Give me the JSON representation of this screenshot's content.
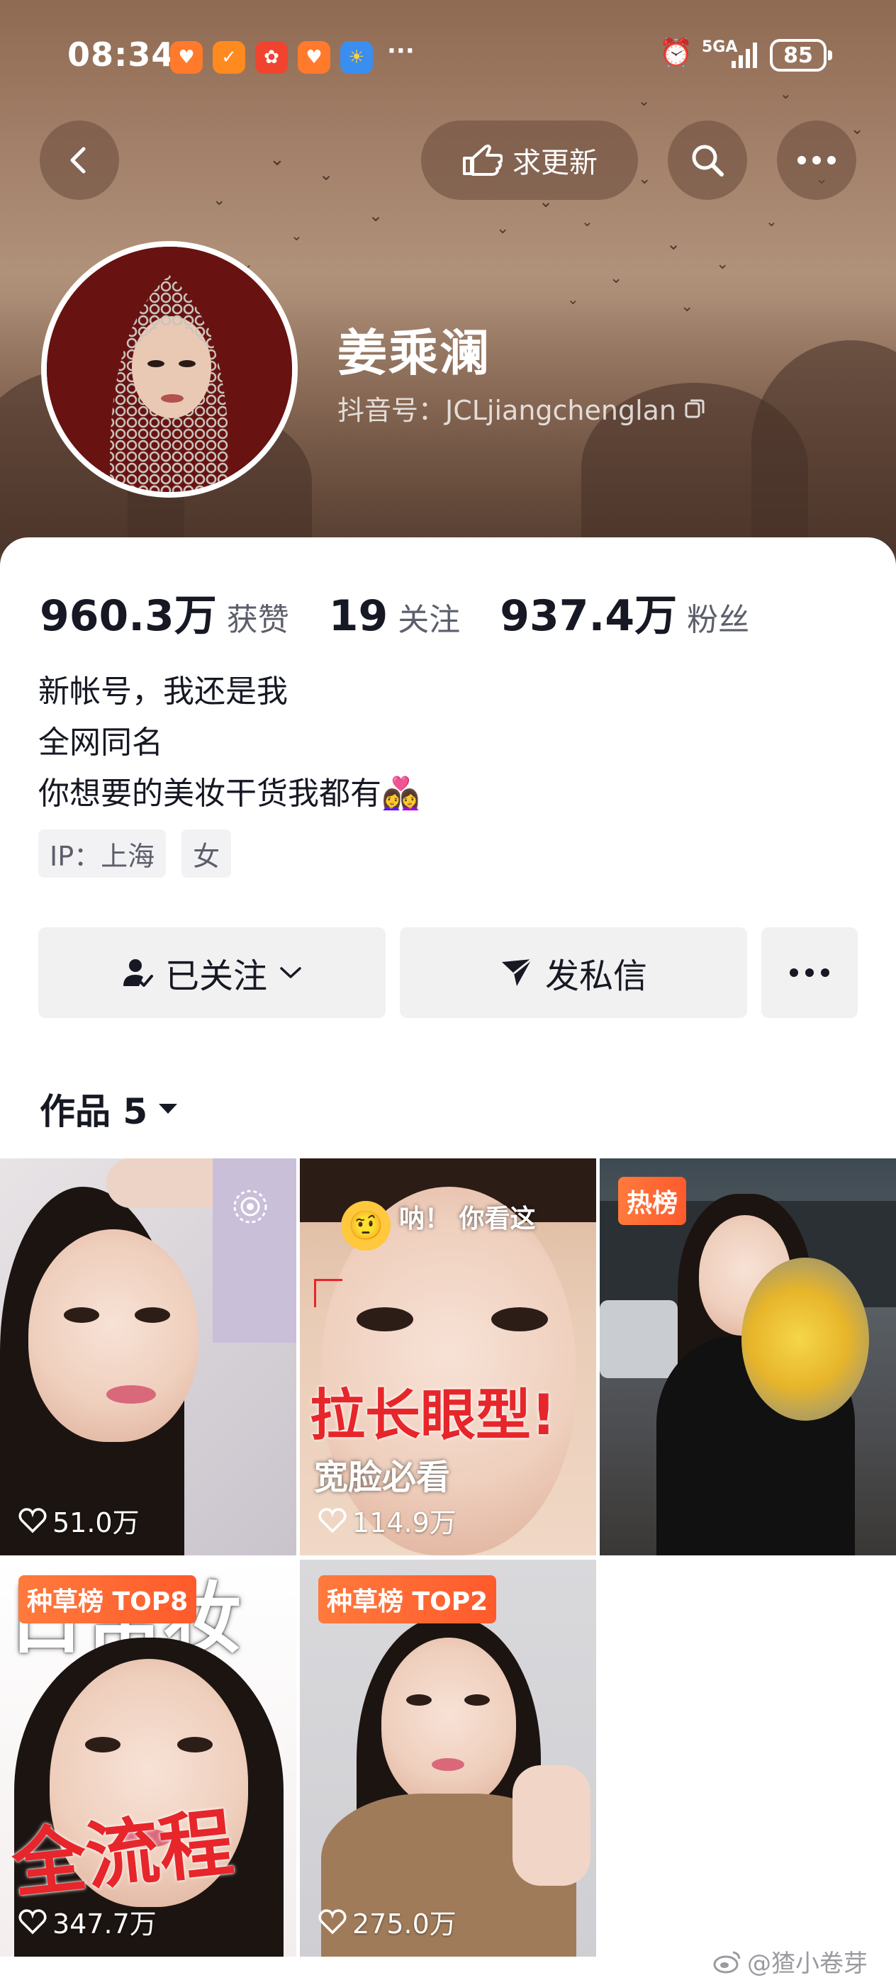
{
  "status_bar": {
    "time": "08:34",
    "more_notifications": "···",
    "network": "5GA",
    "battery": "85"
  },
  "top_nav": {
    "request_update_label": "求更新"
  },
  "profile": {
    "name": "姜乘澜",
    "douyin_id": "抖音号：JCLjiangchenglan"
  },
  "stats": {
    "likes_value": "960.3万",
    "likes_label": "获赞",
    "following_value": "19",
    "following_label": "关注",
    "followers_value": "937.4万",
    "followers_label": "粉丝"
  },
  "bio": {
    "line1": "新帐号，我还是我",
    "line2": "全网同名",
    "line3": "你想要的美妆干货我都有👩‍❤️‍👩"
  },
  "tags": {
    "ip": "IP：上海",
    "gender": "女"
  },
  "actions": {
    "followed_label": "已关注",
    "message_label": "发私信"
  },
  "works_tab": {
    "label": "作品 5"
  },
  "videos": [
    {
      "likes": "51.0万"
    },
    {
      "likes": "114.9万",
      "text_top": "呐！ 你看这",
      "text_big": "拉长眼型!",
      "text_sub": "宽脸必看"
    },
    {
      "badge": "热榜"
    },
    {
      "likes": "347.7万",
      "badge": "种草榜 TOP8",
      "text_top": "日常妆",
      "text_big": "全流程"
    },
    {
      "likes": "275.0万",
      "badge": "种草榜 TOP2"
    }
  ],
  "watermark": "@猹小卷芽"
}
